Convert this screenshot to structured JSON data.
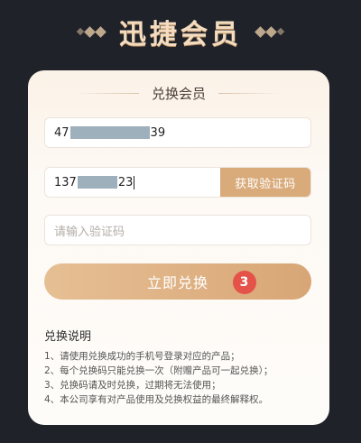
{
  "header": {
    "title": "迅捷会员"
  },
  "card": {
    "title": "兑换会员",
    "redeem_code": {
      "prefix": "47",
      "suffix": "39"
    },
    "phone": {
      "prefix": "137",
      "suffix": "23"
    },
    "get_code_button": "获取验证码",
    "verify_code_placeholder": "请输入验证码",
    "redeem_button": "立即兑换",
    "badge": "3"
  },
  "rules": {
    "title": "兑换说明",
    "items": [
      "1、请使用兑换成功的手机号登录对应的产品；",
      "2、每个兑换码只能兑换一次（附赠产品可一起兑换）；",
      "3、兑换码请及时兑换，过期将无法使用；",
      "4、本公司享有对产品使用及兑换权益的最终解释权。"
    ]
  },
  "colors": {
    "background": "#1f2229",
    "accent": "#d9ab7b",
    "badge": "#e4524a"
  }
}
